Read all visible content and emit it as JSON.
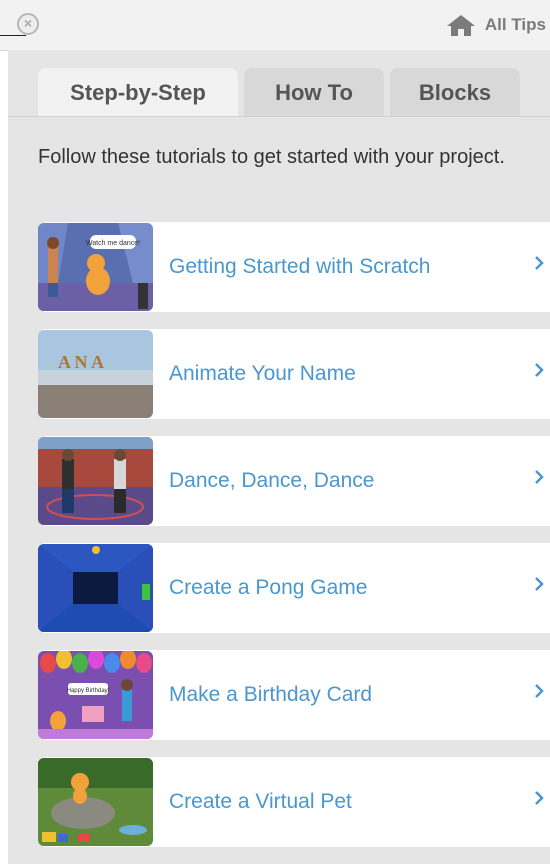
{
  "header": {
    "all_tips_label": "All Tips",
    "close_glyph": "×"
  },
  "tabs": [
    {
      "label": "Step-by-Step",
      "active": true
    },
    {
      "label": "How To",
      "active": false
    },
    {
      "label": "Blocks",
      "active": false
    }
  ],
  "intro": "Follow these tutorials to get started with your project.",
  "tutorials": [
    {
      "title": "Getting Started with Scratch",
      "thumb_caption": "Watch me dance!"
    },
    {
      "title": "Animate Your Name",
      "thumb_caption": "A N A"
    },
    {
      "title": "Dance, Dance, Dance"
    },
    {
      "title": "Create a Pong Game"
    },
    {
      "title": "Make a Birthday Card",
      "thumb_caption": "Happy Birthday!"
    },
    {
      "title": "Create a Virtual Pet"
    }
  ],
  "colors": {
    "link": "#4a97d0",
    "panel": "#e5e5e5",
    "tab_active": "#f2f2f2"
  },
  "icons": {
    "home": "home-icon",
    "close": "close-icon",
    "chevron": "chevron-right-icon"
  }
}
